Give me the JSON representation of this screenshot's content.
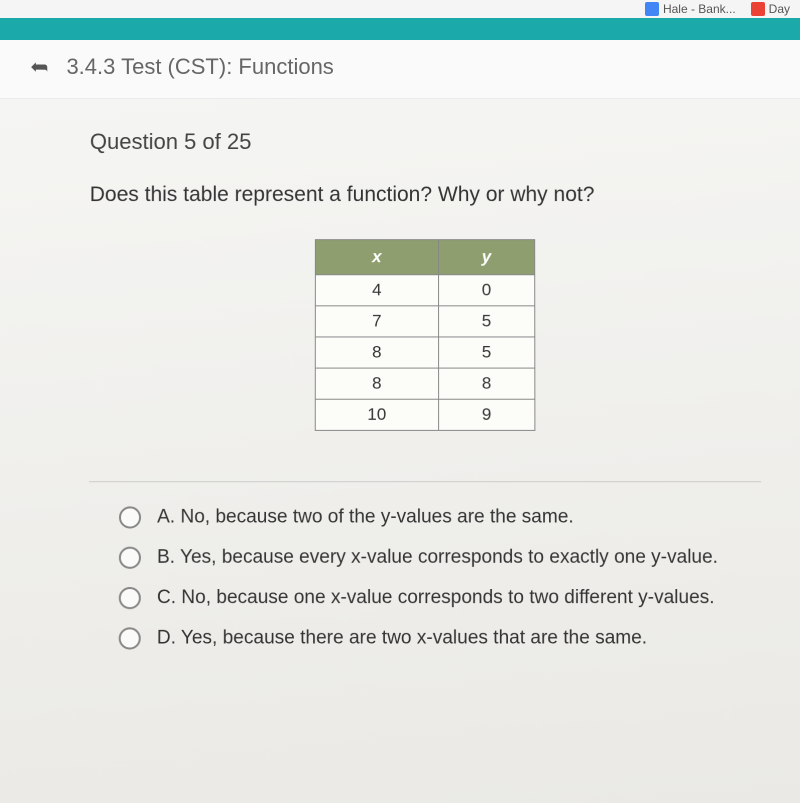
{
  "browser": {
    "bookmark1": "Hale - Bank...",
    "bookmark2": "Day"
  },
  "header": {
    "title": "3.4.3 Test (CST): Functions"
  },
  "question": {
    "label": "Question 5 of 25",
    "text": "Does this table represent a function? Why or why not?"
  },
  "table": {
    "header_x": "x",
    "header_y": "y",
    "rows": [
      {
        "x": "4",
        "y": "0"
      },
      {
        "x": "7",
        "y": "5"
      },
      {
        "x": "8",
        "y": "5"
      },
      {
        "x": "8",
        "y": "8"
      },
      {
        "x": "10",
        "y": "9"
      }
    ]
  },
  "options": {
    "a": "A.  No, because two of the y-values are the same.",
    "b": "B.  Yes, because every x-value corresponds to exactly one y-value.",
    "c": "C.  No, because one x-value corresponds to two different y-values.",
    "d": "D.  Yes, because there are two x-values that are the same."
  }
}
